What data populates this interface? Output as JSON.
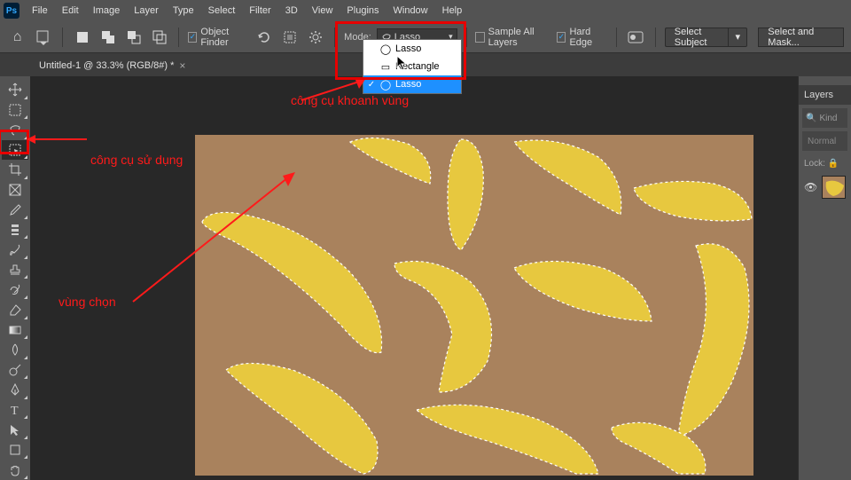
{
  "menu": [
    "File",
    "Edit",
    "Image",
    "Layer",
    "Type",
    "Select",
    "Filter",
    "3D",
    "View",
    "Plugins",
    "Window",
    "Help"
  ],
  "options": {
    "object_finder": "Object Finder",
    "mode_label": "Mode:",
    "mode_value": "Lasso",
    "dd_items": [
      {
        "label": "Lasso",
        "sel": false
      },
      {
        "label": "Rectangle",
        "sel": false
      },
      {
        "label": "Lasso",
        "sel": true
      }
    ],
    "sample_all": "Sample All Layers",
    "hard_edge": "Hard Edge",
    "select_subject": "Select Subject",
    "select_mask": "Select and Mask..."
  },
  "tab": {
    "title": "Untitled-1 @ 33.3% (RGB/8#) *"
  },
  "panel": {
    "title": "Layers",
    "search_placeholder": "Kind",
    "blend": "Normal",
    "lock_label": "Lock:"
  },
  "annotations": {
    "a1": "công cụ khoanh vùng",
    "a2": "công cụ sử dụng",
    "a3": "vùng chọn"
  },
  "chart_data": null
}
